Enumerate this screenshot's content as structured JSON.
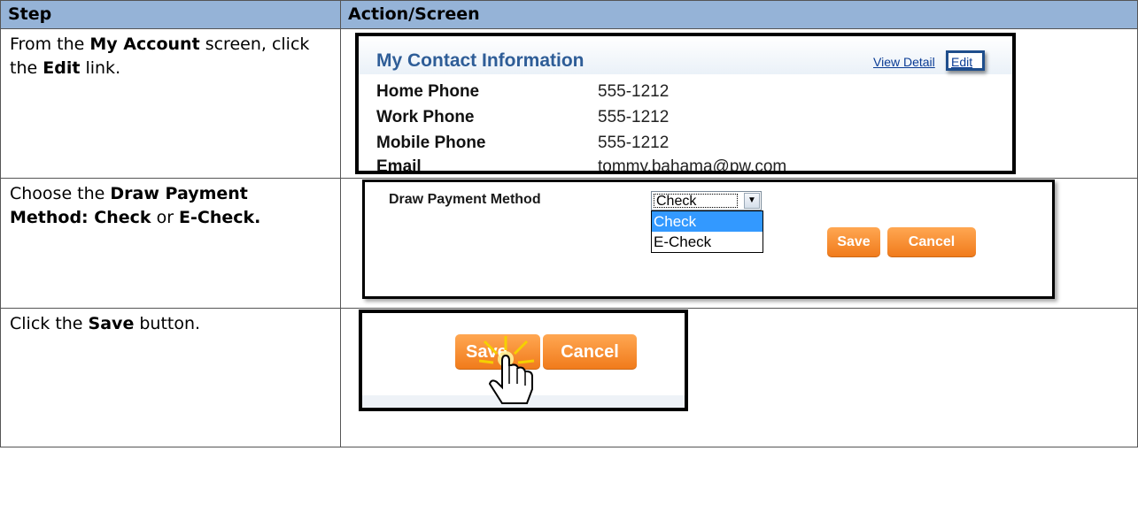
{
  "table": {
    "headers": {
      "step": "Step",
      "action": "Action/Screen"
    },
    "rows": [
      {
        "step": {
          "t1": "From the ",
          "b1": "My Account",
          "t2": " screen, click the ",
          "b2": "Edit",
          "t3": " link."
        }
      },
      {
        "step": {
          "t1": "Choose the ",
          "b1": "Draw Payment Method: Check",
          "t2": " or ",
          "b2": "E-Check."
        }
      },
      {
        "step": {
          "t1": "Click the ",
          "b1": "Save",
          "t2": " button."
        }
      }
    ]
  },
  "contact_screen": {
    "title": "My Contact Information",
    "view_detail": "View Detail",
    "edit": "Edit",
    "fields": [
      {
        "label": "Home Phone",
        "value": "555-1212"
      },
      {
        "label": "Work Phone",
        "value": "555-1212"
      },
      {
        "label": "Mobile Phone",
        "value": "555-1212"
      },
      {
        "label": "Email",
        "value": "tommy.bahama@pw.com"
      }
    ]
  },
  "payment_screen": {
    "label": "Draw Payment Method",
    "selected": "Check",
    "options": [
      "Check",
      "E-Check"
    ],
    "save": "Save",
    "cancel": "Cancel"
  },
  "save_screen": {
    "save": "Save",
    "cancel": "Cancel",
    "icons": {
      "cursor": "hand-pointer-icon",
      "dropdown": "chevron-down-icon"
    }
  },
  "colors": {
    "header_bg": "#95b3d7",
    "button_orange": "#f58a2a",
    "link_blue": "#0a3c95",
    "selected_option": "#3399ff"
  }
}
